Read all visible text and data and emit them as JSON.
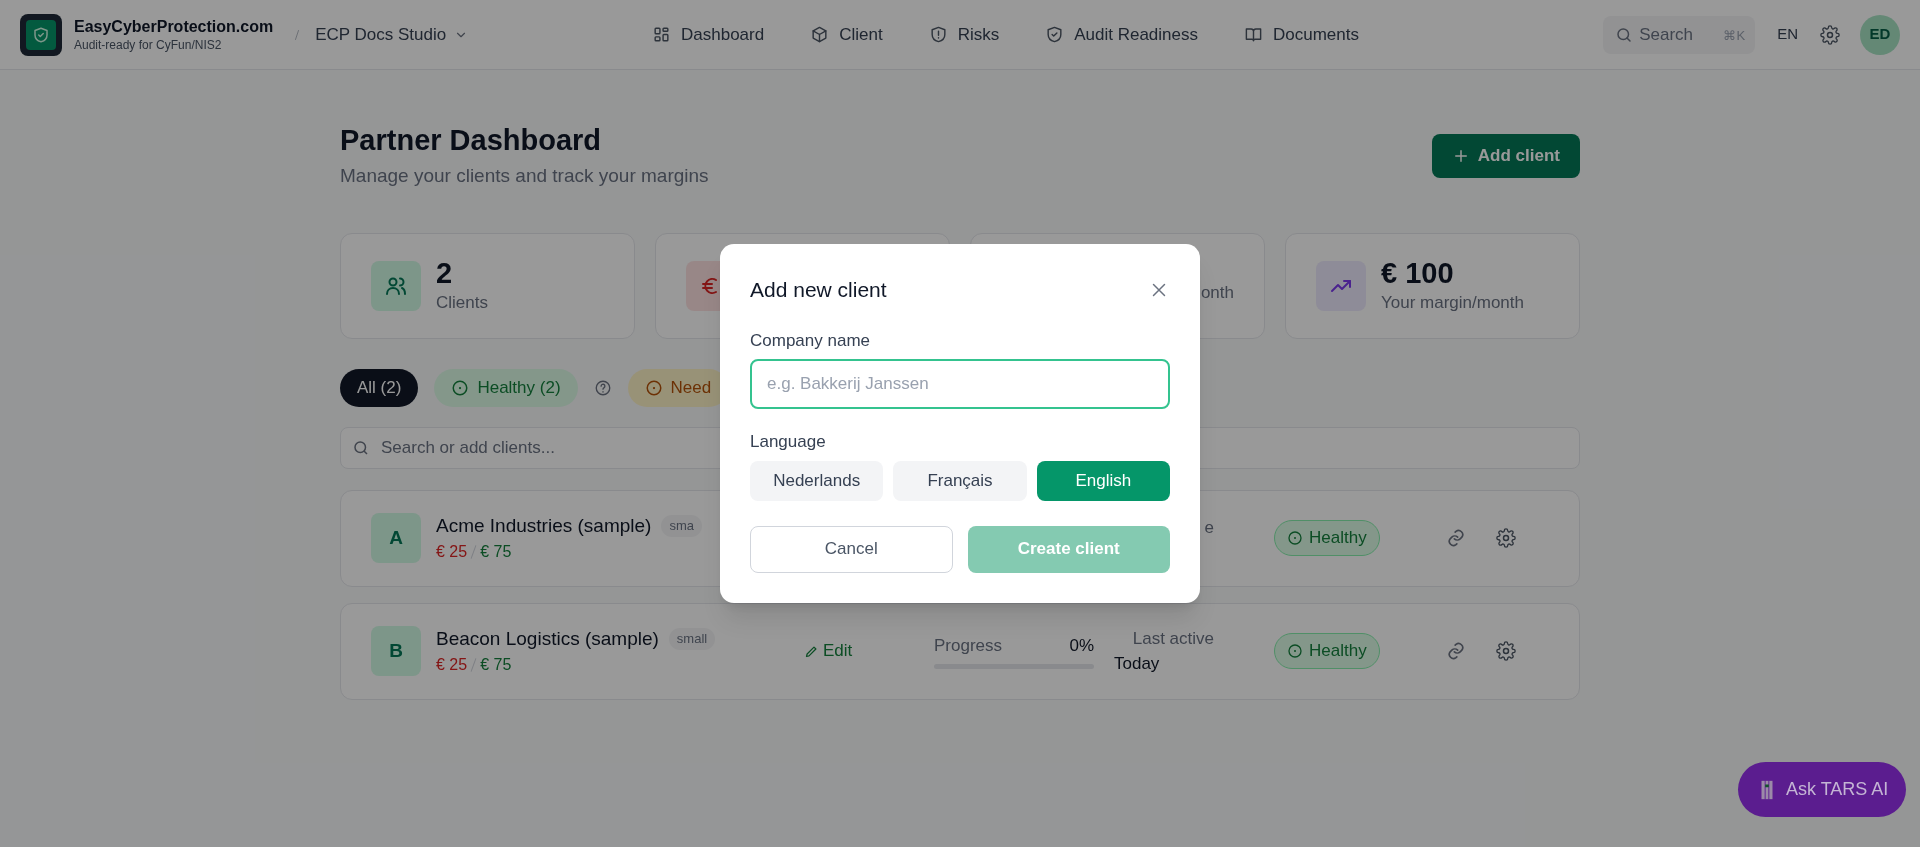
{
  "header": {
    "brand": "EasyCyberProtection.com",
    "tagline": "Audit-ready for CyFun/NIS2",
    "workspace": "ECP Docs Studio",
    "nav": [
      {
        "kind": "grid",
        "label": "Dashboard"
      },
      {
        "kind": "cube",
        "label": "Client"
      },
      {
        "kind": "alert-shield",
        "label": "Risks"
      },
      {
        "kind": "check-shield",
        "label": "Audit Readiness"
      },
      {
        "kind": "book",
        "label": "Documents"
      }
    ],
    "search": {
      "placeholder": "Search",
      "shortcut": "⌘K"
    },
    "language": "EN",
    "avatar": "ED"
  },
  "page": {
    "title": "Partner Dashboard",
    "subtitle": "Manage your clients and track your margins",
    "add_button": "Add client"
  },
  "stats": [
    {
      "kind": "users",
      "value": "2",
      "label": "Clients"
    },
    {
      "kind": "euro"
    },
    {
      "label": "onth"
    },
    {
      "kind": "trend",
      "value": "€ 100",
      "label": "Your margin/month"
    }
  ],
  "filters": [
    {
      "kind": "all",
      "label": "All (2)",
      "selected": true
    },
    {
      "kind": "healthy",
      "label": "Healthy (2)",
      "selected": false,
      "help": true
    },
    {
      "kind": "warning",
      "label": "Need",
      "selected": false
    }
  ],
  "search": {
    "placeholder": "Search or add clients..."
  },
  "clients": [
    {
      "initial": "A",
      "name": "Acme Industries (sample)",
      "size": "sma",
      "cost": "€ 25",
      "price": "€ 75",
      "activity_label": "e",
      "status": "Healthy"
    },
    {
      "initial": "B",
      "name": "Beacon Logistics (sample)",
      "size": "small",
      "cost": "€ 25",
      "price": "€ 75",
      "edit": "Edit",
      "progress_label": "Progress",
      "progress_value": "0%",
      "level": 0,
      "activity_label": "Last active",
      "activity_value": "Today",
      "status": "Healthy"
    }
  ],
  "modal": {
    "title": "Add new client",
    "company_label": "Company name",
    "company_placeholder": "e.g. Bakkerij Janssen",
    "language_label": "Language",
    "languages": [
      {
        "label": "Nederlands",
        "selected": false
      },
      {
        "label": "Français",
        "selected": false
      },
      {
        "label": "English",
        "selected": true
      }
    ],
    "cancel": "Cancel",
    "create": "Create client",
    "create_disabled": true
  },
  "assistant": {
    "label": "Ask TARS AI"
  }
}
